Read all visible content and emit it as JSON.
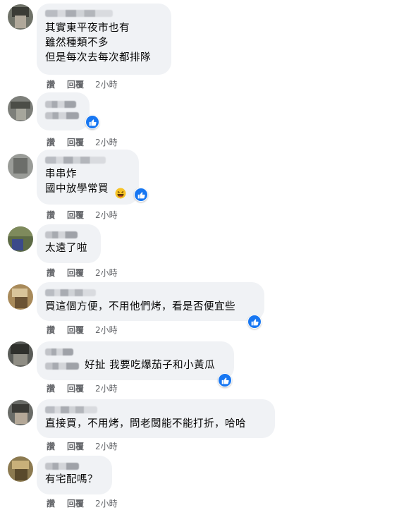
{
  "comments": [
    {
      "text": "其實東平夜市也有\n雖然種類不多\n但是每次去每次都排隊",
      "like_label": "讚",
      "reply_label": "回覆",
      "time": "2小時"
    },
    {
      "text": "",
      "like_label": "讚",
      "reply_label": "回覆",
      "time": "2小時"
    },
    {
      "text": "串串炸\n國中放學常買",
      "like_label": "讚",
      "reply_label": "回覆",
      "time": "2小時"
    },
    {
      "text": "太遠了啦",
      "like_label": "讚",
      "reply_label": "回覆",
      "time": "2小時"
    },
    {
      "text": "買這個方便，不用他們烤，看是否便宜些",
      "like_label": "讚",
      "reply_label": "回覆",
      "time": "2小時"
    },
    {
      "text": "好扯 我要吃爆茄子和小黃瓜",
      "like_label": "讚",
      "reply_label": "回覆",
      "time": "2小時"
    },
    {
      "text": "直接買，不用烤，問老闆能不能打折，哈哈",
      "like_label": "讚",
      "reply_label": "回覆",
      "time": "2小時"
    },
    {
      "text": "有宅配嗎？",
      "like_label": "讚",
      "reply_label": "回覆",
      "time": "2小時"
    }
  ],
  "icons": {
    "like_badge": "thumbs-up-icon",
    "laugh_emoji": "grinning-squinting-emoji",
    "avatar": "blurred-avatar"
  },
  "colors": {
    "bubble": "#f0f2f5",
    "like_blue": "#1877f2",
    "meta_gray": "#65676b"
  }
}
